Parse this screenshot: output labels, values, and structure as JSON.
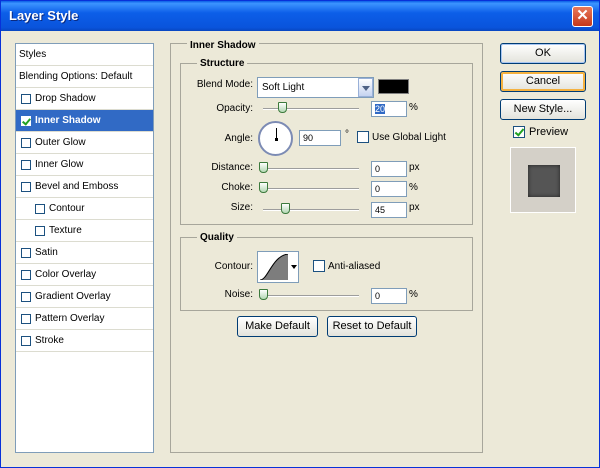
{
  "window": {
    "title": "Layer Style",
    "close_label": "✕"
  },
  "sidebar": {
    "items": [
      {
        "label": "Styles",
        "has_checkbox": false,
        "checked": false,
        "selected": false,
        "indent": 0
      },
      {
        "label": "Blending Options: Default",
        "has_checkbox": false,
        "checked": false,
        "selected": false,
        "indent": 0
      },
      {
        "label": "Drop Shadow",
        "has_checkbox": true,
        "checked": false,
        "selected": false,
        "indent": 0
      },
      {
        "label": "Inner Shadow",
        "has_checkbox": true,
        "checked": true,
        "selected": true,
        "indent": 0
      },
      {
        "label": "Outer Glow",
        "has_checkbox": true,
        "checked": false,
        "selected": false,
        "indent": 0
      },
      {
        "label": "Inner Glow",
        "has_checkbox": true,
        "checked": false,
        "selected": false,
        "indent": 0
      },
      {
        "label": "Bevel and Emboss",
        "has_checkbox": true,
        "checked": false,
        "selected": false,
        "indent": 0
      },
      {
        "label": "Contour",
        "has_checkbox": true,
        "checked": false,
        "selected": false,
        "indent": 1
      },
      {
        "label": "Texture",
        "has_checkbox": true,
        "checked": false,
        "selected": false,
        "indent": 1
      },
      {
        "label": "Satin",
        "has_checkbox": true,
        "checked": false,
        "selected": false,
        "indent": 0
      },
      {
        "label": "Color Overlay",
        "has_checkbox": true,
        "checked": false,
        "selected": false,
        "indent": 0
      },
      {
        "label": "Gradient Overlay",
        "has_checkbox": true,
        "checked": false,
        "selected": false,
        "indent": 0
      },
      {
        "label": "Pattern Overlay",
        "has_checkbox": true,
        "checked": false,
        "selected": false,
        "indent": 0
      },
      {
        "label": "Stroke",
        "has_checkbox": true,
        "checked": false,
        "selected": false,
        "indent": 0
      }
    ]
  },
  "panel": {
    "title": "Inner Shadow",
    "structure": {
      "title": "Structure",
      "blend_mode_label": "Blend Mode:",
      "blend_mode_value": "Soft Light",
      "shadow_color": "#000000",
      "opacity_label": "Opacity:",
      "opacity_value": "20",
      "opacity_unit": "%",
      "angle_label": "Angle:",
      "angle_value": "90",
      "angle_unit": "°",
      "use_global_light_label": "Use Global Light",
      "use_global_light_checked": false,
      "distance_label": "Distance:",
      "distance_value": "0",
      "distance_unit": "px",
      "choke_label": "Choke:",
      "choke_value": "0",
      "choke_unit": "%",
      "size_label": "Size:",
      "size_value": "45",
      "size_unit": "px"
    },
    "quality": {
      "title": "Quality",
      "contour_label": "Contour:",
      "anti_aliased_label": "Anti-aliased",
      "anti_aliased_checked": false,
      "noise_label": "Noise:",
      "noise_value": "0",
      "noise_unit": "%"
    },
    "make_default_label": "Make Default",
    "reset_default_label": "Reset to Default"
  },
  "actions": {
    "ok_label": "OK",
    "cancel_label": "Cancel",
    "new_style_label": "New Style...",
    "preview_label": "Preview",
    "preview_checked": true
  }
}
